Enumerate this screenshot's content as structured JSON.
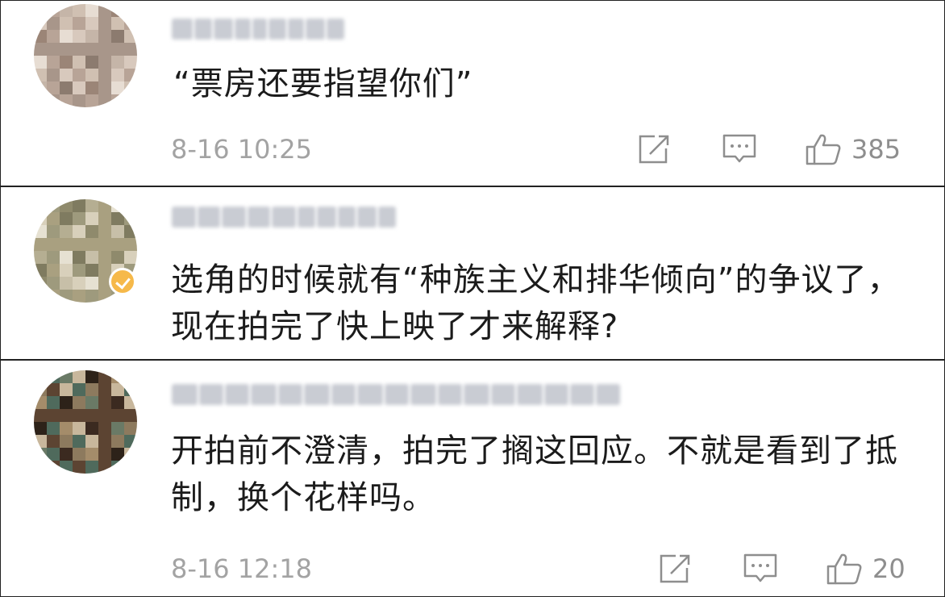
{
  "comments": [
    {
      "username": "wantlaipe",
      "text": "“票房还要指望你们”",
      "timestamp": "8-16 10:25",
      "likes": "385",
      "avatar_colors": [
        "#8c7b6f",
        "#a8968a",
        "#c5b5a8",
        "#d8c9bd",
        "#e7ddd3",
        "#b8a497",
        "#9b8577",
        "#d0c0b2"
      ]
    },
    {
      "username": "寻找林花园 0600",
      "text": "选角的时候就有“种族主义和排华倾向”的争议了，现在拍完了快上映了才来解释?",
      "timestamp": "",
      "likes": "",
      "avatar_colors": [
        "#c7bfa8",
        "#a9a080",
        "#8f8a6c",
        "#d8d0bb",
        "#b5ae92",
        "#9e9a7d",
        "#e6e1d2",
        "#7f7b60"
      ]
    },
    {
      "username": "从前面也的第二排就上就有了",
      "text": "开拍前不澄清，拍完了搁这回应。不就是看到了抵制，换个花样吗。",
      "timestamp": "8-16 12:18",
      "likes": "20",
      "avatar_colors": [
        "#3b2a20",
        "#5c4432",
        "#6a7a66",
        "#8d7a5e",
        "#2d2219",
        "#4f6a5c",
        "#a48c6a",
        "#c8b79c"
      ]
    }
  ],
  "icons": {
    "share": "share-icon",
    "reply": "comment-icon",
    "like": "thumbs-up-icon"
  },
  "colors": {
    "text": "#1b1b1b",
    "meta": "#a3a3a3",
    "icon": "#8e8e8e",
    "divider": "#222222",
    "verified": "#f6b94a"
  }
}
